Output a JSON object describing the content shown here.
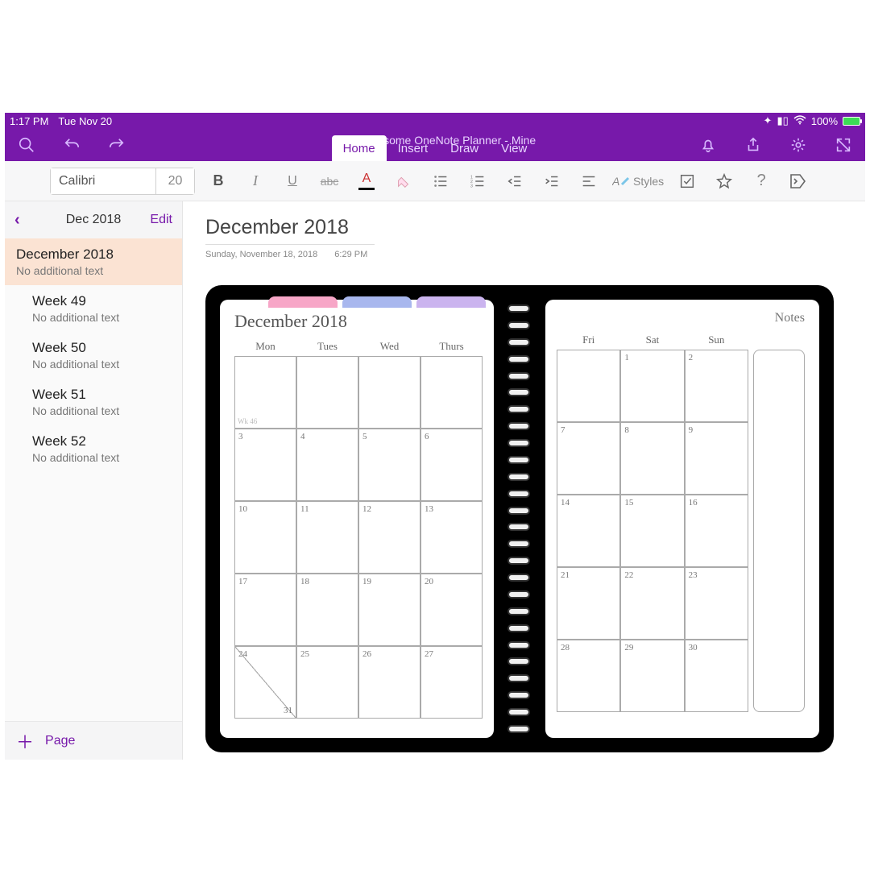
{
  "status": {
    "time": "1:17 PM",
    "date": "Tue Nov 20",
    "battery": "100%"
  },
  "header": {
    "title": "2019 Awesome OneNote Planner - Mine",
    "tabs": [
      "Home",
      "Insert",
      "Draw",
      "View"
    ],
    "active_tab": "Home"
  },
  "ribbon": {
    "font": "Calibri",
    "size": "20",
    "styles_label": "Styles"
  },
  "sidebar": {
    "month": "Dec 2018",
    "edit": "Edit",
    "pages": [
      {
        "title": "December 2018",
        "sub": "No additional text",
        "selected": true,
        "indent": false
      },
      {
        "title": "Week 49",
        "sub": "No additional text",
        "selected": false,
        "indent": true
      },
      {
        "title": "Week 50",
        "sub": "No additional text",
        "selected": false,
        "indent": true
      },
      {
        "title": "Week 51",
        "sub": "No additional text",
        "selected": false,
        "indent": true
      },
      {
        "title": "Week 52",
        "sub": "No additional text",
        "selected": false,
        "indent": true
      }
    ],
    "add": "Page"
  },
  "content": {
    "title": "December 2018",
    "meta_date": "Sunday, November 18, 2018",
    "meta_time": "6:29 PM"
  },
  "planner": {
    "month": "December 2018",
    "notes": "Notes",
    "days_left": [
      "Mon",
      "Tues",
      "Wed",
      "Thurs"
    ],
    "days_right": [
      "Fri",
      "Sat",
      "Sun"
    ],
    "week_label": "Wk 46",
    "rows_left": [
      [
        "",
        "",
        "",
        ""
      ],
      [
        "3",
        "4",
        "5",
        "6"
      ],
      [
        "10",
        "11",
        "12",
        "13"
      ],
      [
        "17",
        "18",
        "19",
        "20"
      ],
      [
        "24",
        "25",
        "26",
        "27"
      ]
    ],
    "split_second": "31",
    "rows_right": [
      [
        "",
        "1",
        "2"
      ],
      [
        "7",
        "8",
        "9"
      ],
      [
        "14",
        "15",
        "16"
      ],
      [
        "21",
        "22",
        "23"
      ],
      [
        "28",
        "29",
        "30"
      ]
    ]
  }
}
